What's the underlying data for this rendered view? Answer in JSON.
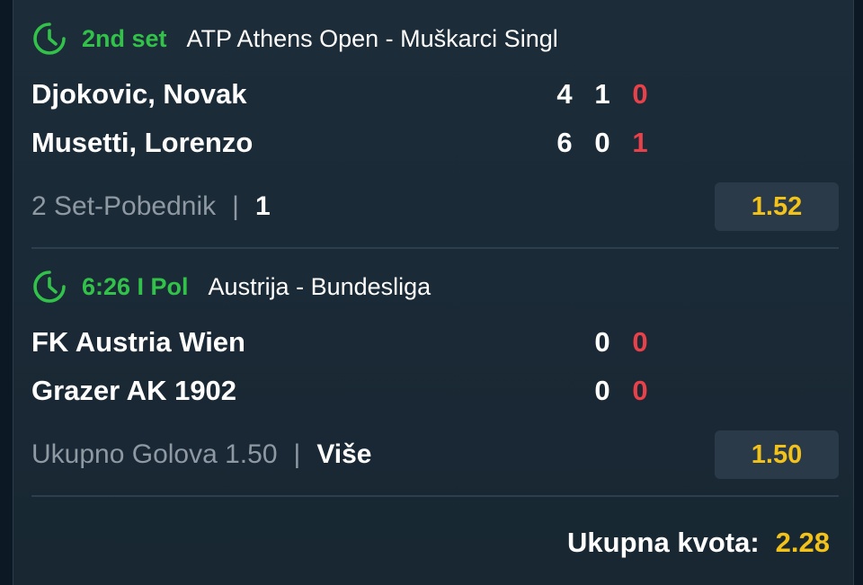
{
  "matches": [
    {
      "status": "2nd set",
      "league": "ATP Athens Open - Muškarci Singl",
      "teams": [
        {
          "name": "Djokovic, Novak",
          "scores": [
            "4",
            "1"
          ],
          "live_score": "0"
        },
        {
          "name": "Musetti, Lorenzo",
          "scores": [
            "6",
            "0"
          ],
          "live_score": "1"
        }
      ],
      "market": "2 Set-Pobednik",
      "pick": "1",
      "odd": "1.52"
    },
    {
      "status": "6:26 I Pol",
      "league": "Austrija - Bundesliga",
      "teams": [
        {
          "name": "FK Austria Wien",
          "scores": [
            "0"
          ],
          "live_score": "0"
        },
        {
          "name": "Grazer AK 1902",
          "scores": [
            "0"
          ],
          "live_score": "0"
        }
      ],
      "market": "Ukupno Golova 1.50",
      "pick": "Više",
      "odd": "1.50"
    }
  ],
  "separator": "|",
  "total": {
    "label": "Ukupna kvota:",
    "value": "2.28"
  },
  "icons": {
    "status": "clock-icon"
  },
  "colors": {
    "live": "#32c24a",
    "odd": "#f2c21b",
    "score_current": "#e8414a"
  }
}
